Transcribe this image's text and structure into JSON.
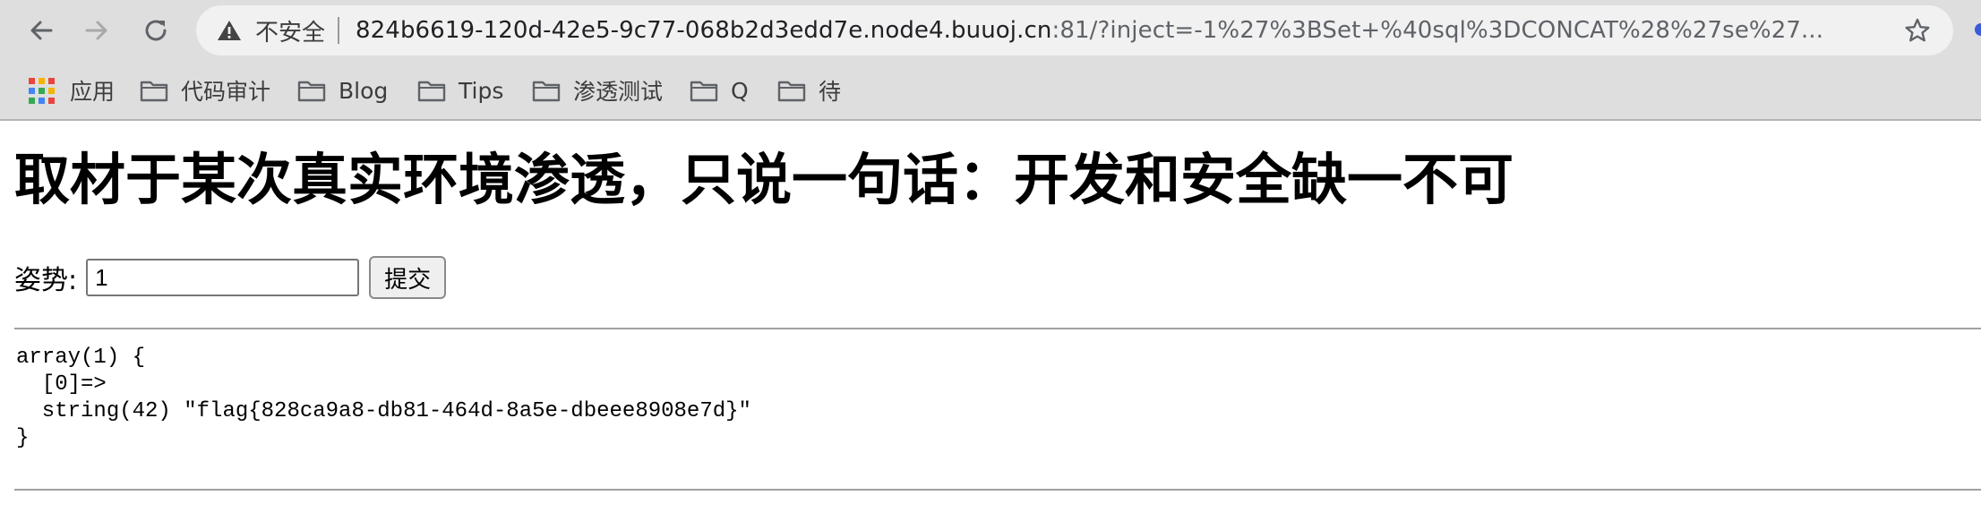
{
  "browser": {
    "security_label": "不安全",
    "url_host": "824b6619-120d-42e5-9c77-068b2d3edd7e.node4.buuoj.cn",
    "url_rest": ":81/?inject=-1%27%3BSet+%40sql%3DCONCAT%28%27se%27..."
  },
  "bookmarks": [
    {
      "label": "应用",
      "icon": "apps-grid-icon"
    },
    {
      "label": "代码审计",
      "icon": "folder-icon"
    },
    {
      "label": "Blog",
      "icon": "folder-icon"
    },
    {
      "label": "Tips",
      "icon": "folder-icon"
    },
    {
      "label": "渗透测试",
      "icon": "folder-icon"
    },
    {
      "label": "Q",
      "icon": "folder-icon"
    },
    {
      "label": "待",
      "icon": "folder-icon"
    }
  ],
  "page": {
    "title": "取材于某次真实环境渗透，只说一句话：开发和安全缺一不可",
    "form": {
      "label": "姿势:",
      "input_value": "1",
      "submit_label": "提交"
    },
    "dump": "array(1) {\n  [0]=>\n  string(42) \"flag{828ca9a8-db81-464d-8a5e-dbeee8908e7d}\"\n}"
  }
}
